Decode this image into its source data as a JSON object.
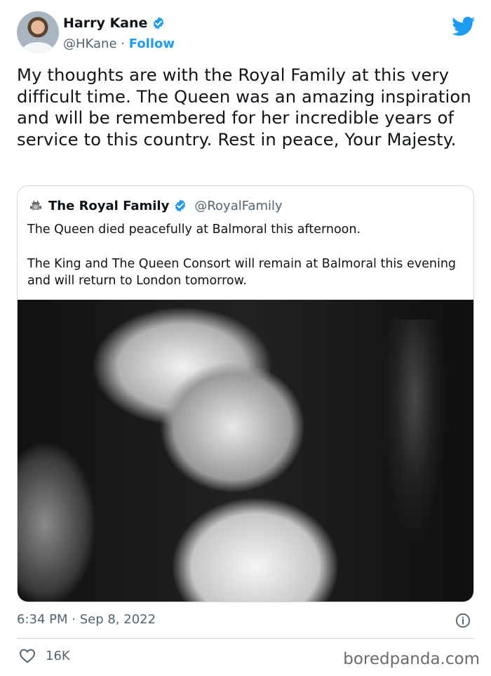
{
  "author": {
    "name": "Harry Kane",
    "handle": "@HKane",
    "separator": "·",
    "follow_label": "Follow"
  },
  "tweet": {
    "text": "My thoughts are with the Royal Family at this very difficult time. The Queen was an amazing inspiration and will be remembered for her incredible years of service to this country. Rest in peace, Your Majesty.",
    "timestamp": "6:34 PM · Sep 8, 2022",
    "likes": "16K"
  },
  "quoted_tweet": {
    "name": "The Royal Family",
    "handle": "@RoyalFamily",
    "paragraphs": [
      "The Queen died peacefully at Balmoral this afternoon.",
      "The King and The Queen Consort will remain at Balmoral this evening and will return to London tomorrow."
    ]
  },
  "watermark": "boredpanda.com",
  "icons": {
    "verified": "verified-badge-icon",
    "platform": "twitter-bird-icon",
    "info": "info-icon",
    "like": "heart-icon",
    "crest": "royal-crest-icon"
  },
  "colors": {
    "accent": "#1d9bf0",
    "text": "#0f1419",
    "muted": "#536471",
    "border": "#cfd9de"
  }
}
